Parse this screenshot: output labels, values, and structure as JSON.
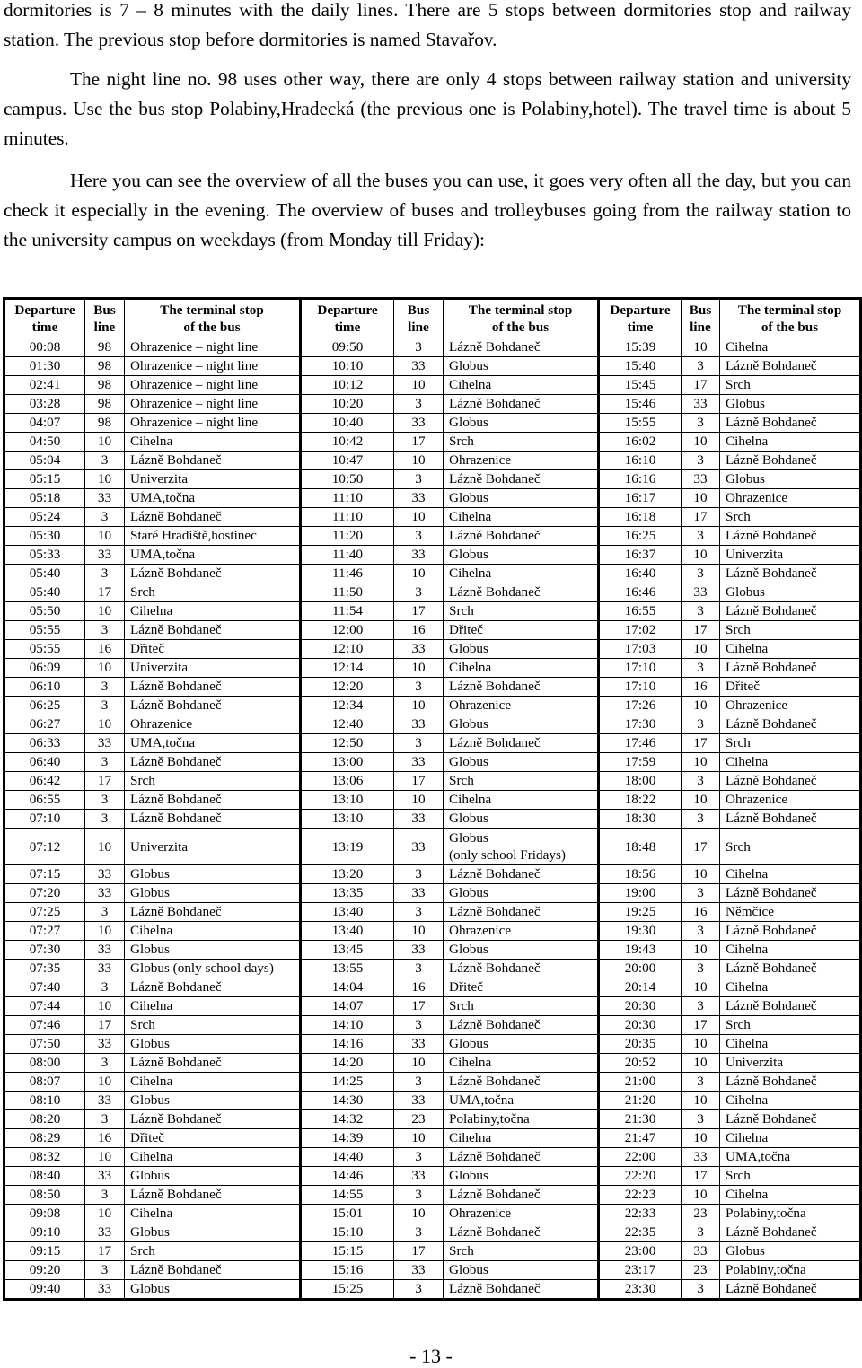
{
  "paragraphs": [
    "dormitories is 7 – 8 minutes with the daily lines. There are 5 stops between dormitories stop and railway station. The previous stop before dormitories is named Stavařov.",
    "The night line no. 98 uses other way, there are only 4 stops between railway station and university campus. Use the bus stop Polabiny,Hradecká (the previous one is Polabiny,hotel). The travel time is about 5 minutes.",
    "Here you can see the overview of all the buses you can use, it goes very often all the day, but you can check it especially in the evening. The overview of buses and trolleybuses going from the railway station to the university campus on weekdays (from Monday till Friday):"
  ],
  "timetable": {
    "headers": {
      "departure": [
        "Departure",
        "time"
      ],
      "line": [
        "Bus",
        "line"
      ],
      "stop": [
        "The terminal stop",
        "of the bus"
      ]
    },
    "rows": [
      [
        [
          "00:08",
          "98",
          "Ohrazenice – night line"
        ],
        [
          "09:50",
          "3",
          "Lázně Bohdaneč"
        ],
        [
          "15:39",
          "10",
          "Cihelna"
        ]
      ],
      [
        [
          "01:30",
          "98",
          "Ohrazenice – night line"
        ],
        [
          "10:10",
          "33",
          "Globus"
        ],
        [
          "15:40",
          "3",
          "Lázně Bohdaneč"
        ]
      ],
      [
        [
          "02:41",
          "98",
          "Ohrazenice – night line"
        ],
        [
          "10:12",
          "10",
          "Cihelna"
        ],
        [
          "15:45",
          "17",
          "Srch"
        ]
      ],
      [
        [
          "03:28",
          "98",
          "Ohrazenice – night line"
        ],
        [
          "10:20",
          "3",
          "Lázně Bohdaneč"
        ],
        [
          "15:46",
          "33",
          "Globus"
        ]
      ],
      [
        [
          "04:07",
          "98",
          "Ohrazenice – night line"
        ],
        [
          "10:40",
          "33",
          "Globus"
        ],
        [
          "15:55",
          "3",
          "Lázně Bohdaneč"
        ]
      ],
      [
        [
          "04:50",
          "10",
          "Cihelna"
        ],
        [
          "10:42",
          "17",
          "Srch"
        ],
        [
          "16:02",
          "10",
          "Cihelna"
        ]
      ],
      [
        [
          "05:04",
          "3",
          "Lázně Bohdaneč"
        ],
        [
          "10:47",
          "10",
          "Ohrazenice"
        ],
        [
          "16:10",
          "3",
          "Lázně Bohdaneč"
        ]
      ],
      [
        [
          "05:15",
          "10",
          "Univerzita"
        ],
        [
          "10:50",
          "3",
          "Lázně Bohdaneč"
        ],
        [
          "16:16",
          "33",
          "Globus"
        ]
      ],
      [
        [
          "05:18",
          "33",
          "UMA,točna"
        ],
        [
          "11:10",
          "33",
          "Globus"
        ],
        [
          "16:17",
          "10",
          "Ohrazenice"
        ]
      ],
      [
        [
          "05:24",
          "3",
          "Lázně Bohdaneč"
        ],
        [
          "11:10",
          "10",
          "Cihelna"
        ],
        [
          "16:18",
          "17",
          "Srch"
        ]
      ],
      [
        [
          "05:30",
          "10",
          "Staré Hradiště,hostinec"
        ],
        [
          "11:20",
          "3",
          "Lázně Bohdaneč"
        ],
        [
          "16:25",
          "3",
          "Lázně Bohdaneč"
        ]
      ],
      [
        [
          "05:33",
          "33",
          "UMA,točna"
        ],
        [
          "11:40",
          "33",
          "Globus"
        ],
        [
          "16:37",
          "10",
          "Univerzita"
        ]
      ],
      [
        [
          "05:40",
          "3",
          "Lázně Bohdaneč"
        ],
        [
          "11:46",
          "10",
          "Cihelna"
        ],
        [
          "16:40",
          "3",
          "Lázně Bohdaneč"
        ]
      ],
      [
        [
          "05:40",
          "17",
          "Srch"
        ],
        [
          "11:50",
          "3",
          "Lázně Bohdaneč"
        ],
        [
          "16:46",
          "33",
          "Globus"
        ]
      ],
      [
        [
          "05:50",
          "10",
          "Cihelna"
        ],
        [
          "11:54",
          "17",
          "Srch"
        ],
        [
          "16:55",
          "3",
          "Lázně Bohdaneč"
        ]
      ],
      [
        [
          "05:55",
          "3",
          "Lázně Bohdaneč"
        ],
        [
          "12:00",
          "16",
          "Dřiteč"
        ],
        [
          "17:02",
          "17",
          "Srch"
        ]
      ],
      [
        [
          "05:55",
          "16",
          "Dřiteč"
        ],
        [
          "12:10",
          "33",
          "Globus"
        ],
        [
          "17:03",
          "10",
          "Cihelna"
        ]
      ],
      [
        [
          "06:09",
          "10",
          "Univerzita"
        ],
        [
          "12:14",
          "10",
          "Cihelna"
        ],
        [
          "17:10",
          "3",
          "Lázně Bohdaneč"
        ]
      ],
      [
        [
          "06:10",
          "3",
          "Lázně Bohdaneč"
        ],
        [
          "12:20",
          "3",
          "Lázně Bohdaneč"
        ],
        [
          "17:10",
          "16",
          "Dřiteč"
        ]
      ],
      [
        [
          "06:25",
          "3",
          "Lázně Bohdaneč"
        ],
        [
          "12:34",
          "10",
          "Ohrazenice"
        ],
        [
          "17:26",
          "10",
          "Ohrazenice"
        ]
      ],
      [
        [
          "06:27",
          "10",
          "Ohrazenice"
        ],
        [
          "12:40",
          "33",
          "Globus"
        ],
        [
          "17:30",
          "3",
          "Lázně Bohdaneč"
        ]
      ],
      [
        [
          "06:33",
          "33",
          "UMA,točna"
        ],
        [
          "12:50",
          "3",
          "Lázně Bohdaneč"
        ],
        [
          "17:46",
          "17",
          "Srch"
        ]
      ],
      [
        [
          "06:40",
          "3",
          "Lázně Bohdaneč"
        ],
        [
          "13:00",
          "33",
          "Globus"
        ],
        [
          "17:59",
          "10",
          "Cihelna"
        ]
      ],
      [
        [
          "06:42",
          "17",
          "Srch"
        ],
        [
          "13:06",
          "17",
          "Srch"
        ],
        [
          "18:00",
          "3",
          "Lázně Bohdaneč"
        ]
      ],
      [
        [
          "06:55",
          "3",
          "Lázně Bohdaneč"
        ],
        [
          "13:10",
          "10",
          "Cihelna"
        ],
        [
          "18:22",
          "10",
          "Ohrazenice"
        ]
      ],
      [
        [
          "07:10",
          "3",
          "Lázně Bohdaneč"
        ],
        [
          "13:10",
          "33",
          "Globus"
        ],
        [
          "18:30",
          "3",
          "Lázně Bohdaneč"
        ]
      ],
      [
        [
          "07:12",
          "10",
          "Univerzita"
        ],
        [
          "13:19",
          "33",
          "Globus\n(only school Fridays)"
        ],
        [
          "18:48",
          "17",
          "Srch"
        ]
      ],
      [
        [
          "07:15",
          "33",
          "Globus"
        ],
        [
          "13:20",
          "3",
          "Lázně Bohdaneč"
        ],
        [
          "18:56",
          "10",
          "Cihelna"
        ]
      ],
      [
        [
          "07:20",
          "33",
          "Globus"
        ],
        [
          "13:35",
          "33",
          "Globus"
        ],
        [
          "19:00",
          "3",
          "Lázně Bohdaneč"
        ]
      ],
      [
        [
          "07:25",
          "3",
          "Lázně Bohdaneč"
        ],
        [
          "13:40",
          "3",
          "Lázně Bohdaneč"
        ],
        [
          "19:25",
          "16",
          "Němčice"
        ]
      ],
      [
        [
          "07:27",
          "10",
          "Cihelna"
        ],
        [
          "13:40",
          "10",
          "Ohrazenice"
        ],
        [
          "19:30",
          "3",
          "Lázně Bohdaneč"
        ]
      ],
      [
        [
          "07:30",
          "33",
          "Globus"
        ],
        [
          "13:45",
          "33",
          "Globus"
        ],
        [
          "19:43",
          "10",
          "Cihelna"
        ]
      ],
      [
        [
          "07:35",
          "33",
          "Globus (only school days)"
        ],
        [
          "13:55",
          "3",
          "Lázně Bohdaneč"
        ],
        [
          "20:00",
          "3",
          "Lázně Bohdaneč"
        ]
      ],
      [
        [
          "07:40",
          "3",
          "Lázně Bohdaneč"
        ],
        [
          "14:04",
          "16",
          "Dřiteč"
        ],
        [
          "20:14",
          "10",
          "Cihelna"
        ]
      ],
      [
        [
          "07:44",
          "10",
          "Cihelna"
        ],
        [
          "14:07",
          "17",
          "Srch"
        ],
        [
          "20:30",
          "3",
          "Lázně Bohdaneč"
        ]
      ],
      [
        [
          "07:46",
          "17",
          "Srch"
        ],
        [
          "14:10",
          "3",
          "Lázně Bohdaneč"
        ],
        [
          "20:30",
          "17",
          "Srch"
        ]
      ],
      [
        [
          "07:50",
          "33",
          "Globus"
        ],
        [
          "14:16",
          "33",
          "Globus"
        ],
        [
          "20:35",
          "10",
          "Cihelna"
        ]
      ],
      [
        [
          "08:00",
          "3",
          "Lázně Bohdaneč"
        ],
        [
          "14:20",
          "10",
          "Cihelna"
        ],
        [
          "20:52",
          "10",
          "Univerzita"
        ]
      ],
      [
        [
          "08:07",
          "10",
          "Cihelna"
        ],
        [
          "14:25",
          "3",
          "Lázně Bohdaneč"
        ],
        [
          "21:00",
          "3",
          "Lázně Bohdaneč"
        ]
      ],
      [
        [
          "08:10",
          "33",
          "Globus"
        ],
        [
          "14:30",
          "33",
          "UMA,točna"
        ],
        [
          "21:20",
          "10",
          "Cihelna"
        ]
      ],
      [
        [
          "08:20",
          "3",
          "Lázně Bohdaneč"
        ],
        [
          "14:32",
          "23",
          "Polabiny,točna"
        ],
        [
          "21:30",
          "3",
          "Lázně Bohdaneč"
        ]
      ],
      [
        [
          "08:29",
          "16",
          "Dřiteč"
        ],
        [
          "14:39",
          "10",
          "Cihelna"
        ],
        [
          "21:47",
          "10",
          "Cihelna"
        ]
      ],
      [
        [
          "08:32",
          "10",
          "Cihelna"
        ],
        [
          "14:40",
          "3",
          "Lázně Bohdaneč"
        ],
        [
          "22:00",
          "33",
          "UMA,točna"
        ]
      ],
      [
        [
          "08:40",
          "33",
          "Globus"
        ],
        [
          "14:46",
          "33",
          "Globus"
        ],
        [
          "22:20",
          "17",
          "Srch"
        ]
      ],
      [
        [
          "08:50",
          "3",
          "Lázně Bohdaneč"
        ],
        [
          "14:55",
          "3",
          "Lázně Bohdaneč"
        ],
        [
          "22:23",
          "10",
          "Cihelna"
        ]
      ],
      [
        [
          "09:08",
          "10",
          "Cihelna"
        ],
        [
          "15:01",
          "10",
          "Ohrazenice"
        ],
        [
          "22:33",
          "23",
          "Polabiny,točna"
        ]
      ],
      [
        [
          "09:10",
          "33",
          "Globus"
        ],
        [
          "15:10",
          "3",
          "Lázně Bohdaneč"
        ],
        [
          "22:35",
          "3",
          "Lázně Bohdaneč"
        ]
      ],
      [
        [
          "09:15",
          "17",
          "Srch"
        ],
        [
          "15:15",
          "17",
          "Srch"
        ],
        [
          "23:00",
          "33",
          "Globus"
        ]
      ],
      [
        [
          "09:20",
          "3",
          "Lázně Bohdaneč"
        ],
        [
          "15:16",
          "33",
          "Globus"
        ],
        [
          "23:17",
          "23",
          "Polabiny,točna"
        ]
      ],
      [
        [
          "09:40",
          "33",
          "Globus"
        ],
        [
          "15:25",
          "3",
          "Lázně Bohdaneč"
        ],
        [
          "23:30",
          "3",
          "Lázně Bohdaneč"
        ]
      ]
    ],
    "tall_row_index": 26
  },
  "page_number": "- 13 -"
}
